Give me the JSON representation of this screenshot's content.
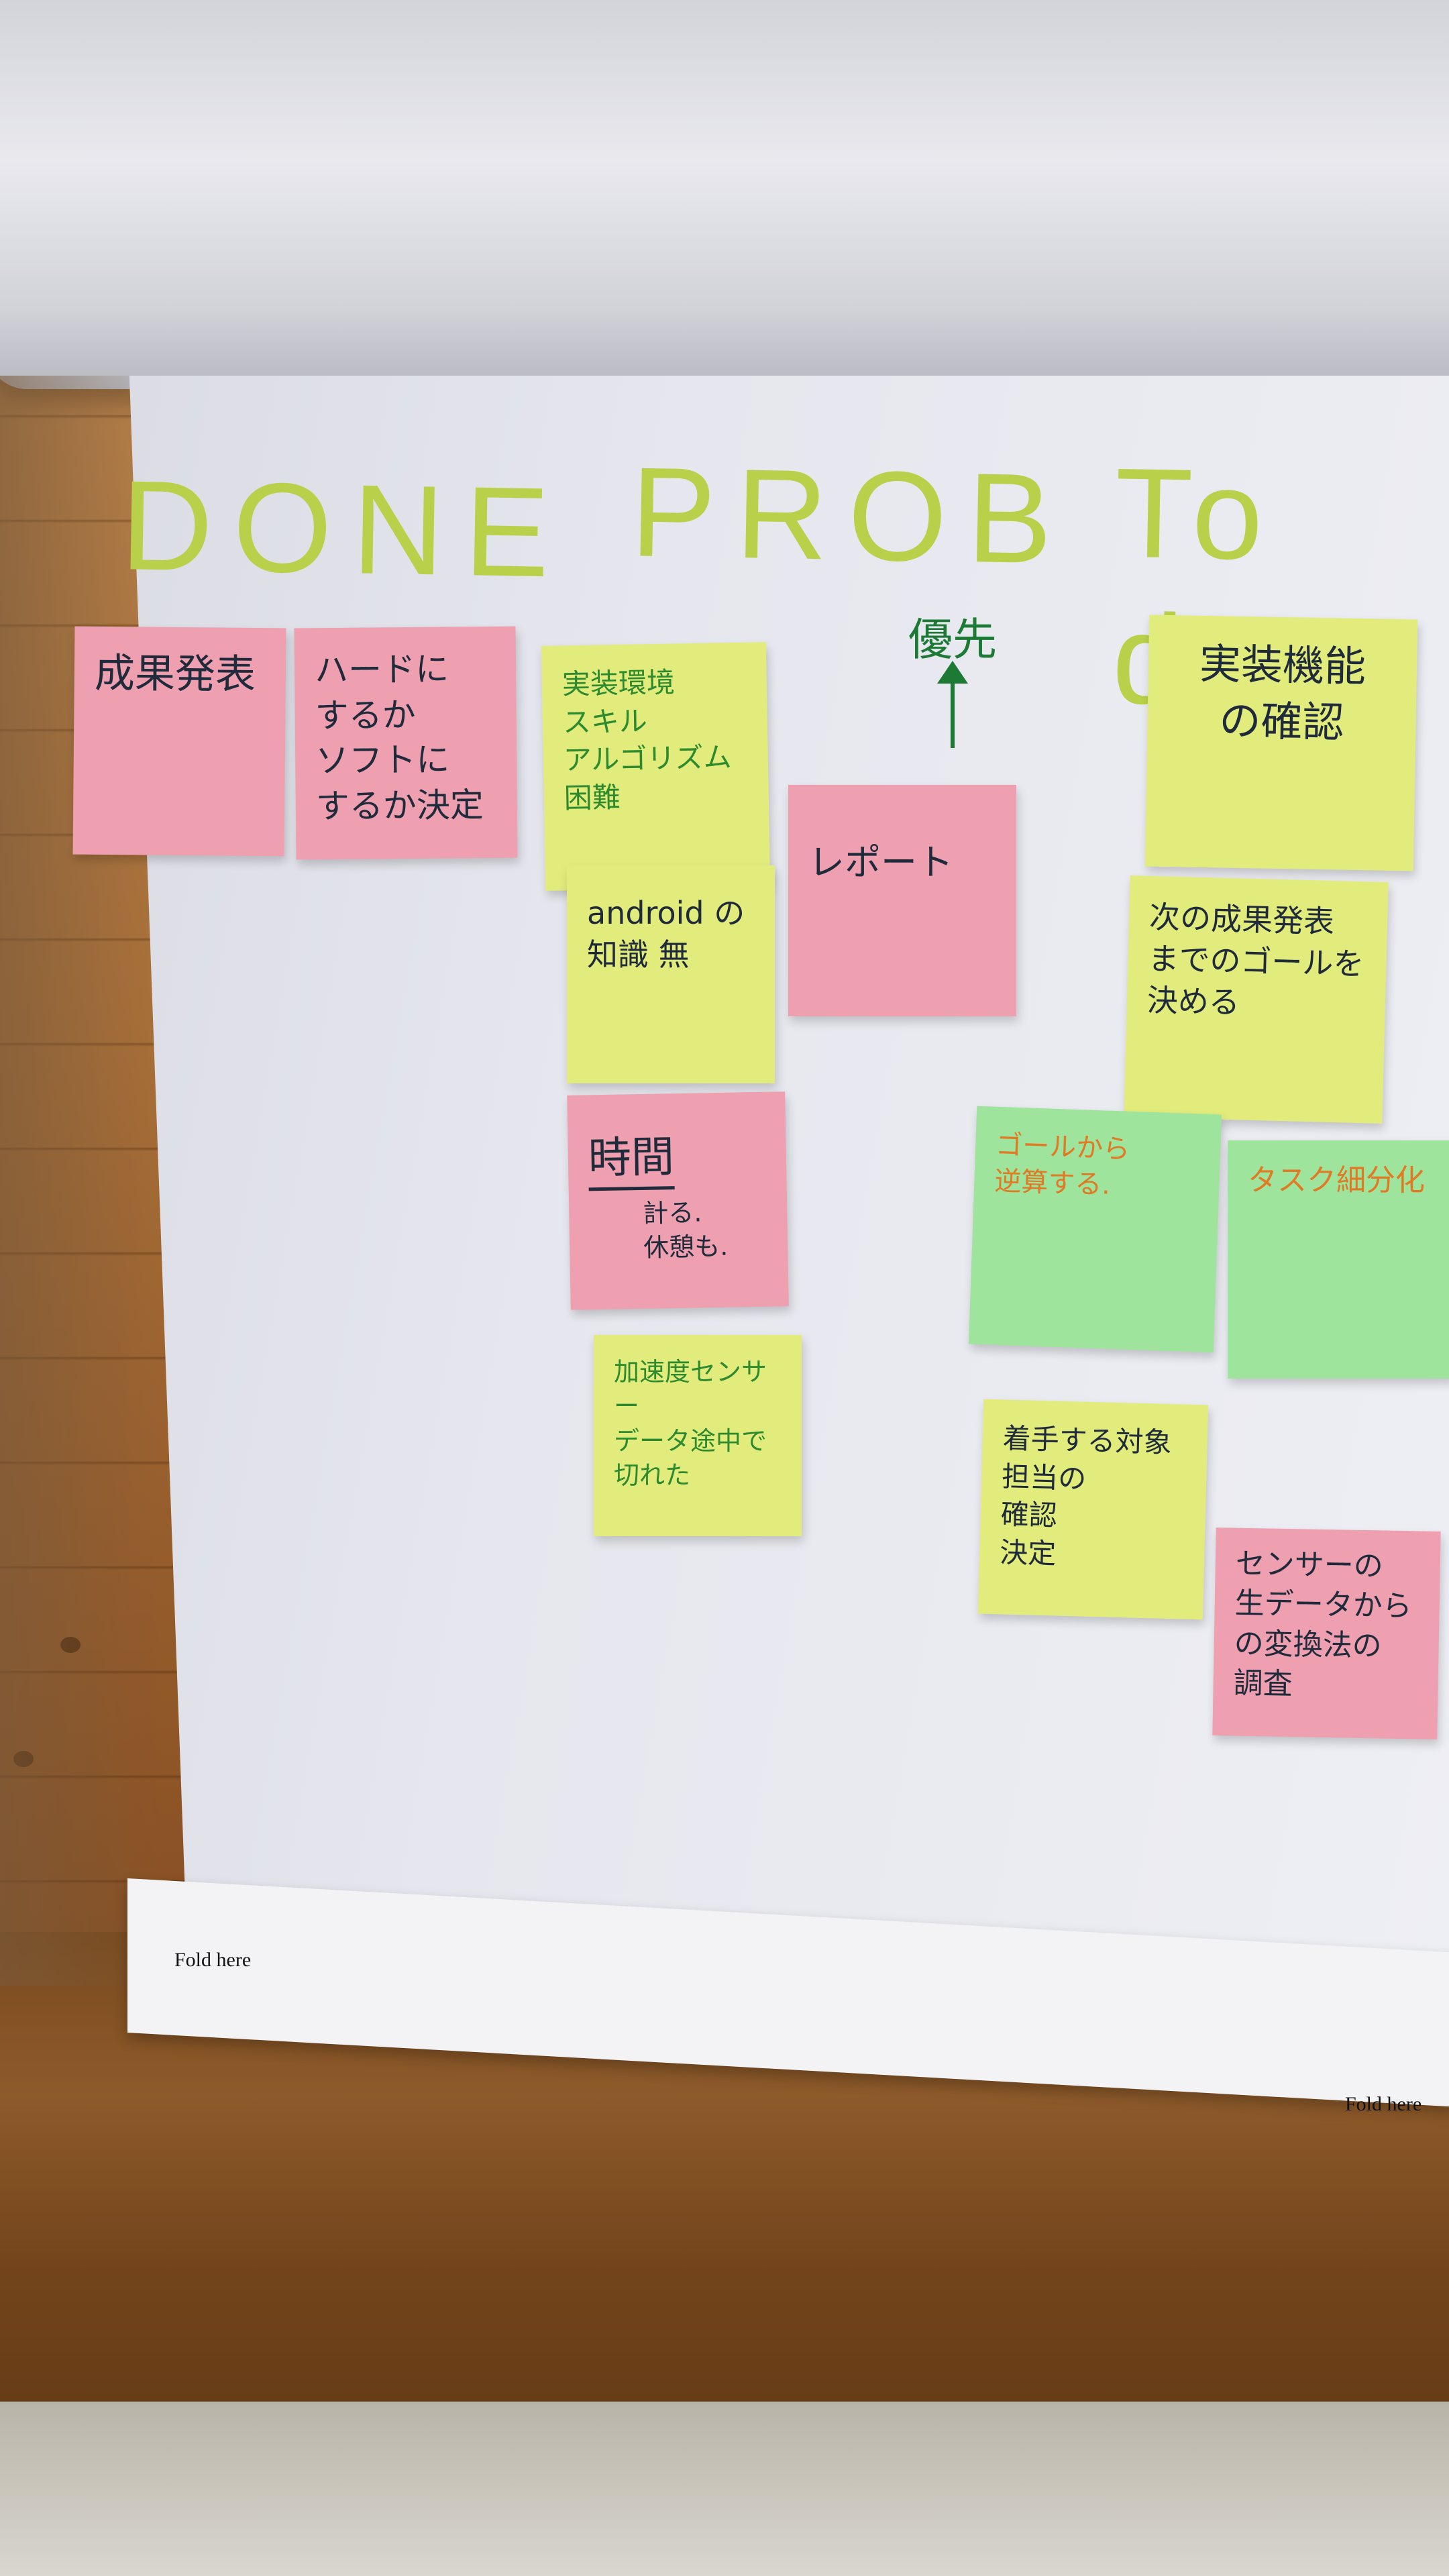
{
  "headers": {
    "done": "DONE",
    "prob": "PROB",
    "todo": "To do"
  },
  "priority": {
    "label": "優先"
  },
  "notes": {
    "done_1": "成果発表",
    "done_2": "ハードに\nするか\nソフトに\nするか決定",
    "prob_1": "実装環境\nスキル\nアルゴリズム\n困難",
    "prob_1b": "android の\n知識 無",
    "prob_2": "レポート",
    "prob_3_title": "時間",
    "prob_3_body": "計る.\n休憩も.",
    "prob_4": "加速度センサー\nデータ途中で\n切れた",
    "todo_1": "実装機能\nの確認",
    "todo_2": "次の成果発表\nまでのゴールを\n決める",
    "todo_3": "ゴールから\n逆算する.",
    "todo_4": "タスク細分化",
    "todo_5": "着手する対象\n担当の\n確認\n決定",
    "todo_6": "センサーの\n生データから\nの変換法の\n調査"
  },
  "fold": {
    "left": "Fold here",
    "right": "Fold here"
  },
  "colors": {
    "header_green": "#b9d14a",
    "note_pink": "#ee9fb0",
    "note_yellow": "#e2ec7c",
    "note_green": "#9fe49c"
  }
}
